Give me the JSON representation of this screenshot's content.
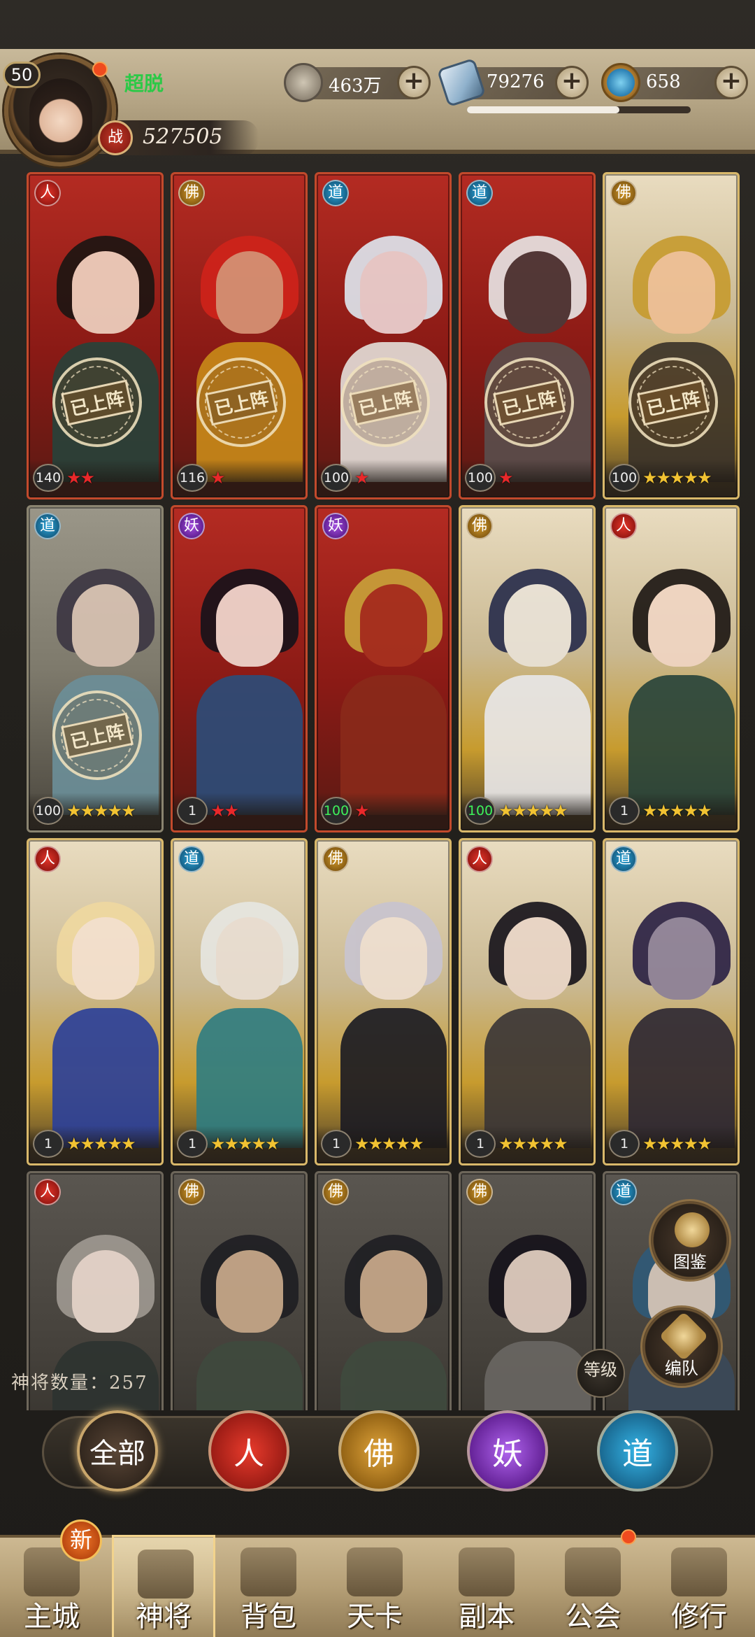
{
  "player": {
    "level": "50",
    "name": "超脱",
    "power_label": "战",
    "power": "527505"
  },
  "resources": [
    {
      "icon": "coin-icon",
      "value": "463万"
    },
    {
      "icon": "scroll-icon",
      "value": "79276"
    },
    {
      "icon": "gem-icon",
      "value": "658"
    }
  ],
  "exp_fraction": 0.68,
  "stamp_text": "已上阵",
  "heroes": [
    {
      "faction": "人",
      "fclass": "f-ren",
      "bg": "red",
      "level": "140",
      "stars": "★★",
      "star_color": "red",
      "deployed": true,
      "hair": "#1b1512",
      "skin": "#f1d6c4",
      "robe": "#27433a"
    },
    {
      "faction": "佛",
      "fclass": "f-fo",
      "bg": "red",
      "level": "116",
      "stars": "★",
      "star_color": "red",
      "deployed": true,
      "hair": "#d0231a",
      "skin": "#d99678",
      "robe": "#c98b18"
    },
    {
      "faction": "道",
      "fclass": "f-dao",
      "bg": "red",
      "level": "100",
      "stars": "★",
      "star_color": "red",
      "deployed": true,
      "hair": "#dfe8f0",
      "skin": "#eed7d6",
      "robe": "#e4e0da"
    },
    {
      "faction": "道",
      "fclass": "f-dao",
      "bg": "red",
      "level": "100",
      "stars": "★",
      "star_color": "red",
      "deployed": true,
      "hair": "#e8e6e6",
      "skin": "#4b3a3a",
      "robe": "#5a4f4c"
    },
    {
      "faction": "佛",
      "fclass": "f-fo",
      "bg": "gold",
      "level": "100",
      "stars": "★★★★★",
      "star_color": "gold",
      "deployed": true,
      "hair": "#c79b2e",
      "skin": "#efbf94",
      "robe": "#3a3229"
    },
    {
      "faction": "道",
      "fclass": "f-dao",
      "bg": "ghost",
      "level": "100",
      "stars": "★★★★★",
      "star_color": "gold",
      "deployed": true,
      "hair": "#3b3542",
      "skin": "#d9c3b3",
      "robe": "#6c8f99"
    },
    {
      "faction": "妖",
      "fclass": "f-yao",
      "bg": "red",
      "level": "1",
      "stars": "★★",
      "star_color": "red",
      "deployed": false,
      "hair": "#16121a",
      "skin": "#f2ddd4",
      "robe": "#2b4e7a"
    },
    {
      "faction": "妖",
      "fclass": "f-yao",
      "bg": "red",
      "level": "100",
      "level_green": true,
      "stars": "★",
      "star_color": "red",
      "deployed": false,
      "hair": "#c9a33a",
      "skin": "#a8321f",
      "robe": "#8a2a1a"
    },
    {
      "faction": "佛",
      "fclass": "f-fo",
      "bg": "gold",
      "level": "100",
      "level_green": true,
      "stars": "★★★★★",
      "star_color": "gold",
      "deployed": false,
      "hair": "#262b4a",
      "skin": "#eae3d8",
      "robe": "#e9e8ea"
    },
    {
      "faction": "人",
      "fclass": "f-ren",
      "bg": "gold",
      "level": "1",
      "stars": "★★★★★",
      "star_color": "gold",
      "deployed": false,
      "hair": "#1b1512",
      "skin": "#f1d6c4",
      "robe": "#27433a"
    },
    {
      "faction": "人",
      "fclass": "f-ren",
      "bg": "gold",
      "level": "1",
      "stars": "★★★★★",
      "star_color": "gold",
      "deployed": false,
      "hair": "#f0d9a0",
      "skin": "#f6e2d0",
      "robe": "#2a3f9a"
    },
    {
      "faction": "道",
      "fclass": "f-dao",
      "bg": "gold",
      "level": "1",
      "stars": "★★★★★",
      "star_color": "gold",
      "deployed": false,
      "hair": "#e7e7e2",
      "skin": "#eadfd4",
      "robe": "#2e7d82"
    },
    {
      "faction": "佛",
      "fclass": "f-fo",
      "bg": "gold",
      "level": "1",
      "stars": "★★★★★",
      "star_color": "gold",
      "deployed": false,
      "hair": "#c8c4d0",
      "skin": "#efe0d2",
      "robe": "#1a1a22"
    },
    {
      "faction": "人",
      "fclass": "f-ren",
      "bg": "gold",
      "level": "1",
      "stars": "★★★★★",
      "star_color": "gold",
      "deployed": false,
      "hair": "#15121a",
      "skin": "#ead6c8",
      "robe": "#3a3536"
    },
    {
      "faction": "道",
      "fclass": "f-dao",
      "bg": "gold",
      "level": "1",
      "stars": "★★★★★",
      "star_color": "gold",
      "deployed": false,
      "hair": "#2a2044",
      "skin": "#8b7f97",
      "robe": "#2c2733"
    },
    {
      "faction": "人",
      "fclass": "f-ren",
      "bg": "grey",
      "level": "",
      "stars": "",
      "star_color": "gold",
      "deployed": false,
      "hair": "#a09a92",
      "skin": "#efddd2",
      "robe": "#2d3330"
    },
    {
      "faction": "佛",
      "fclass": "f-fo",
      "bg": "grey",
      "level": "",
      "stars": "",
      "star_color": "gold",
      "deployed": false,
      "hair": "#1e1e22",
      "skin": "#c9a98a",
      "robe": "#3f4a3e"
    },
    {
      "faction": "佛",
      "fclass": "f-fo",
      "bg": "grey",
      "level": "",
      "stars": "",
      "star_color": "gold",
      "deployed": false,
      "hair": "#1e1e22",
      "skin": "#c9a98a",
      "robe": "#3f4a3e"
    },
    {
      "faction": "佛",
      "fclass": "f-fo",
      "bg": "grey",
      "level": "",
      "stars": "",
      "star_color": "gold",
      "deployed": false,
      "hair": "#15121a",
      "skin": "#e3cfc2",
      "robe": "#6a6763"
    },
    {
      "faction": "道",
      "fclass": "f-dao",
      "bg": "grey",
      "level": "",
      "stars": "",
      "star_color": "gold",
      "deployed": false,
      "hair": "#2f5a78",
      "skin": "#d9cbbf",
      "robe": "#3b4a5a"
    }
  ],
  "hero_count_label": "神将数量：257",
  "side_buttons": {
    "codex": "图鉴",
    "formation": "编队",
    "sort_level": "等级"
  },
  "filters": [
    {
      "label": "全部",
      "cls": "all"
    },
    {
      "label": "人",
      "cls": "ren"
    },
    {
      "label": "佛",
      "cls": "fo"
    },
    {
      "label": "妖",
      "cls": "yao"
    },
    {
      "label": "道",
      "cls": "dao"
    }
  ],
  "nav": [
    {
      "label": "主城"
    },
    {
      "label": "神将"
    },
    {
      "label": "背包"
    },
    {
      "label": "天卡"
    },
    {
      "label": "副本"
    },
    {
      "label": "公会"
    },
    {
      "label": "修行"
    }
  ],
  "new_badge": "新"
}
